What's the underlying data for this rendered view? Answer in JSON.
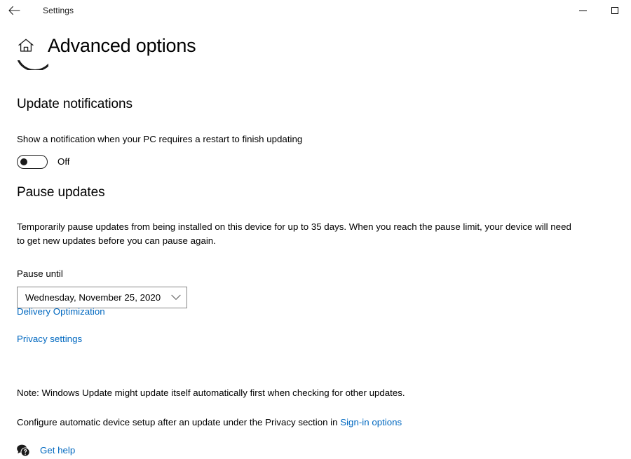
{
  "window": {
    "title": "Settings",
    "back_icon": "back-arrow-icon",
    "controls": {
      "minimize_label": "Minimize",
      "maximize_label": "Maximize"
    }
  },
  "page": {
    "home_icon": "home-icon",
    "title": "Advanced options"
  },
  "update_notifications": {
    "heading": "Update notifications",
    "description": "Show a notification when your PC requires a restart to finish updating",
    "toggle": {
      "state_label": "Off",
      "checked": false
    }
  },
  "pause_updates": {
    "heading": "Pause updates",
    "description": "Temporarily pause updates from being installed on this device for up to 35 days. When you reach the pause limit, your device will need to get new updates before you can pause again.",
    "field_label": "Pause until",
    "dropdown": {
      "value": "Wednesday, November 25, 2020",
      "chevron_icon": "chevron-down-icon"
    }
  },
  "links": {
    "delivery_optimization": "Delivery Optimization",
    "privacy_settings": "Privacy settings"
  },
  "notes": {
    "line1": "Note: Windows Update might update itself automatically first when checking for other updates.",
    "line2_prefix": "Configure automatic device setup after an update under the Privacy section in ",
    "line2_link": "Sign-in options"
  },
  "footer": {
    "help_icon": "help-question-bubble-icon",
    "get_help_label": "Get help"
  },
  "colors": {
    "link_blue": "#0068c0",
    "text_black": "#000000",
    "border_gray": "#878787",
    "background": "#ffffff"
  }
}
